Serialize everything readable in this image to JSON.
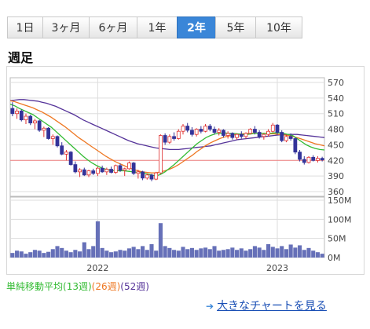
{
  "tabs": [
    {
      "label": "1日",
      "active": false
    },
    {
      "label": "3ヶ月",
      "active": false
    },
    {
      "label": "6ヶ月",
      "active": false
    },
    {
      "label": "1年",
      "active": false
    },
    {
      "label": "2年",
      "active": true
    },
    {
      "label": "5年",
      "active": false
    },
    {
      "label": "10年",
      "active": false
    }
  ],
  "chart_title": "週足",
  "legend": {
    "prefix": "単純移動平均",
    "ma13": "(13週)",
    "ma26": "(26週)",
    "ma52": "(52週)"
  },
  "colors": {
    "ma13": "#33bb33",
    "ma26": "#ee7722",
    "ma52": "#553399",
    "up": "#e03030",
    "down": "#333399",
    "volume": "#6670b8",
    "ref_line": "#f08080",
    "active_tab": "#3a86d8"
  },
  "link": {
    "label": "大きなチャートを見る"
  },
  "chart_data": {
    "type": "candlestick",
    "price_axis": {
      "ticks": [
        "570",
        "540",
        "510",
        "480",
        "450",
        "420",
        "390",
        "360"
      ],
      "ylim": [
        360,
        570
      ],
      "reference_line": 420
    },
    "volume_axis": {
      "ticks": [
        "150M",
        "100M",
        "50M",
        "0M"
      ],
      "ylim": [
        0,
        150
      ]
    },
    "x_tick_labels": [
      "2022",
      "2023"
    ],
    "candles": [
      {
        "o": 520,
        "h": 532,
        "l": 505,
        "c": 510
      },
      {
        "o": 510,
        "h": 520,
        "l": 500,
        "c": 515
      },
      {
        "o": 515,
        "h": 518,
        "l": 495,
        "c": 498
      },
      {
        "o": 498,
        "h": 510,
        "l": 490,
        "c": 505
      },
      {
        "o": 505,
        "h": 508,
        "l": 488,
        "c": 492
      },
      {
        "o": 492,
        "h": 500,
        "l": 480,
        "c": 496
      },
      {
        "o": 496,
        "h": 498,
        "l": 475,
        "c": 478
      },
      {
        "o": 478,
        "h": 485,
        "l": 465,
        "c": 482
      },
      {
        "o": 482,
        "h": 484,
        "l": 460,
        "c": 462
      },
      {
        "o": 462,
        "h": 470,
        "l": 450,
        "c": 466
      },
      {
        "o": 466,
        "h": 468,
        "l": 445,
        "c": 448
      },
      {
        "o": 448,
        "h": 455,
        "l": 430,
        "c": 432
      },
      {
        "o": 432,
        "h": 440,
        "l": 420,
        "c": 436
      },
      {
        "o": 436,
        "h": 438,
        "l": 410,
        "c": 412
      },
      {
        "o": 412,
        "h": 418,
        "l": 395,
        "c": 398
      },
      {
        "o": 398,
        "h": 405,
        "l": 388,
        "c": 402
      },
      {
        "o": 402,
        "h": 406,
        "l": 390,
        "c": 392
      },
      {
        "o": 392,
        "h": 402,
        "l": 388,
        "c": 400
      },
      {
        "o": 400,
        "h": 404,
        "l": 392,
        "c": 395
      },
      {
        "o": 395,
        "h": 408,
        "l": 390,
        "c": 405
      },
      {
        "o": 405,
        "h": 410,
        "l": 396,
        "c": 398
      },
      {
        "o": 398,
        "h": 406,
        "l": 392,
        "c": 403
      },
      {
        "o": 403,
        "h": 408,
        "l": 395,
        "c": 397
      },
      {
        "o": 397,
        "h": 412,
        "l": 394,
        "c": 410
      },
      {
        "o": 410,
        "h": 414,
        "l": 398,
        "c": 401
      },
      {
        "o": 401,
        "h": 406,
        "l": 390,
        "c": 404
      },
      {
        "o": 404,
        "h": 418,
        "l": 402,
        "c": 415
      },
      {
        "o": 415,
        "h": 417,
        "l": 392,
        "c": 395
      },
      {
        "o": 395,
        "h": 402,
        "l": 385,
        "c": 398
      },
      {
        "o": 398,
        "h": 400,
        "l": 382,
        "c": 386
      },
      {
        "o": 386,
        "h": 395,
        "l": 383,
        "c": 392
      },
      {
        "o": 392,
        "h": 394,
        "l": 380,
        "c": 384
      },
      {
        "o": 384,
        "h": 398,
        "l": 382,
        "c": 396
      },
      {
        "o": 396,
        "h": 470,
        "l": 394,
        "c": 468
      },
      {
        "o": 468,
        "h": 472,
        "l": 450,
        "c": 455
      },
      {
        "o": 455,
        "h": 470,
        "l": 452,
        "c": 466
      },
      {
        "o": 466,
        "h": 474,
        "l": 458,
        "c": 462
      },
      {
        "o": 462,
        "h": 480,
        "l": 460,
        "c": 476
      },
      {
        "o": 476,
        "h": 490,
        "l": 470,
        "c": 486
      },
      {
        "o": 486,
        "h": 492,
        "l": 474,
        "c": 478
      },
      {
        "o": 478,
        "h": 484,
        "l": 466,
        "c": 470
      },
      {
        "o": 470,
        "h": 482,
        "l": 466,
        "c": 480
      },
      {
        "o": 480,
        "h": 486,
        "l": 472,
        "c": 476
      },
      {
        "o": 476,
        "h": 490,
        "l": 474,
        "c": 486
      },
      {
        "o": 486,
        "h": 490,
        "l": 476,
        "c": 480
      },
      {
        "o": 480,
        "h": 485,
        "l": 470,
        "c": 474
      },
      {
        "o": 474,
        "h": 482,
        "l": 468,
        "c": 478
      },
      {
        "o": 478,
        "h": 480,
        "l": 464,
        "c": 468
      },
      {
        "o": 468,
        "h": 476,
        "l": 462,
        "c": 472
      },
      {
        "o": 472,
        "h": 474,
        "l": 460,
        "c": 464
      },
      {
        "o": 464,
        "h": 472,
        "l": 460,
        "c": 470
      },
      {
        "o": 470,
        "h": 476,
        "l": 462,
        "c": 466
      },
      {
        "o": 466,
        "h": 474,
        "l": 462,
        "c": 472
      },
      {
        "o": 472,
        "h": 482,
        "l": 470,
        "c": 480
      },
      {
        "o": 480,
        "h": 486,
        "l": 470,
        "c": 474
      },
      {
        "o": 474,
        "h": 478,
        "l": 462,
        "c": 466
      },
      {
        "o": 466,
        "h": 472,
        "l": 460,
        "c": 470
      },
      {
        "o": 470,
        "h": 480,
        "l": 466,
        "c": 476
      },
      {
        "o": 476,
        "h": 492,
        "l": 474,
        "c": 488
      },
      {
        "o": 488,
        "h": 490,
        "l": 470,
        "c": 474
      },
      {
        "o": 474,
        "h": 478,
        "l": 455,
        "c": 458
      },
      {
        "o": 458,
        "h": 470,
        "l": 455,
        "c": 466
      },
      {
        "o": 466,
        "h": 472,
        "l": 458,
        "c": 462
      },
      {
        "o": 462,
        "h": 464,
        "l": 432,
        "c": 436
      },
      {
        "o": 436,
        "h": 440,
        "l": 418,
        "c": 422
      },
      {
        "o": 422,
        "h": 428,
        "l": 412,
        "c": 416
      },
      {
        "o": 416,
        "h": 428,
        "l": 414,
        "c": 426
      },
      {
        "o": 426,
        "h": 430,
        "l": 418,
        "c": 420
      },
      {
        "o": 420,
        "h": 428,
        "l": 416,
        "c": 424
      },
      {
        "o": 424,
        "h": 427,
        "l": 418,
        "c": 421
      }
    ],
    "ma13": [
      528,
      525,
      520,
      516,
      512,
      508,
      502,
      496,
      490,
      484,
      476,
      468,
      460,
      452,
      444,
      436,
      428,
      421,
      415,
      410,
      406,
      403,
      401,
      400,
      400,
      400,
      399,
      398,
      397,
      396,
      394,
      392,
      390,
      393,
      398,
      405,
      412,
      420,
      428,
      436,
      444,
      452,
      458,
      464,
      468,
      471,
      472,
      473,
      472,
      472,
      471,
      470,
      470,
      471,
      472,
      472,
      472,
      472,
      473,
      473,
      472,
      470,
      468,
      462,
      456,
      450,
      446,
      443,
      441,
      440
    ],
    "ma26": [
      535,
      533,
      530,
      527,
      524,
      521,
      517,
      513,
      508,
      503,
      497,
      491,
      485,
      478,
      471,
      464,
      458,
      452,
      446,
      440,
      434,
      428,
      423,
      418,
      414,
      410,
      406,
      403,
      400,
      398,
      397,
      396,
      396,
      398,
      400,
      403,
      407,
      412,
      418,
      424,
      430,
      437,
      443,
      449,
      454,
      458,
      462,
      465,
      467,
      469,
      470,
      471,
      472,
      472,
      472,
      472,
      472,
      471,
      471,
      470,
      469,
      468,
      466,
      464,
      461,
      458,
      455,
      452,
      450,
      448
    ],
    "ma52": [
      535,
      536,
      537,
      537,
      536,
      535,
      534,
      532,
      530,
      527,
      524,
      520,
      516,
      512,
      508,
      503,
      498,
      494,
      490,
      486,
      482,
      478,
      474,
      470,
      466,
      462,
      458,
      455,
      452,
      450,
      448,
      446,
      444,
      443,
      442,
      441,
      441,
      441,
      442,
      443,
      444,
      445,
      446,
      447,
      448,
      450,
      452,
      454,
      456,
      458,
      460,
      461,
      462,
      463,
      464,
      465,
      466,
      467,
      468,
      469,
      470,
      470,
      470,
      470,
      469,
      468,
      467,
      466,
      465,
      464
    ],
    "volume": [
      12,
      18,
      16,
      10,
      14,
      20,
      18,
      12,
      15,
      22,
      30,
      25,
      18,
      14,
      20,
      16,
      40,
      22,
      30,
      95,
      25,
      18,
      14,
      16,
      20,
      18,
      24,
      28,
      22,
      30,
      20,
      35,
      18,
      90,
      30,
      25,
      20,
      18,
      28,
      22,
      25,
      20,
      24,
      26,
      22,
      30,
      18,
      20,
      22,
      26,
      20,
      24,
      18,
      22,
      30,
      26,
      20,
      35,
      28,
      24,
      30,
      22,
      34,
      26,
      32,
      20,
      25,
      18,
      14,
      10
    ]
  }
}
